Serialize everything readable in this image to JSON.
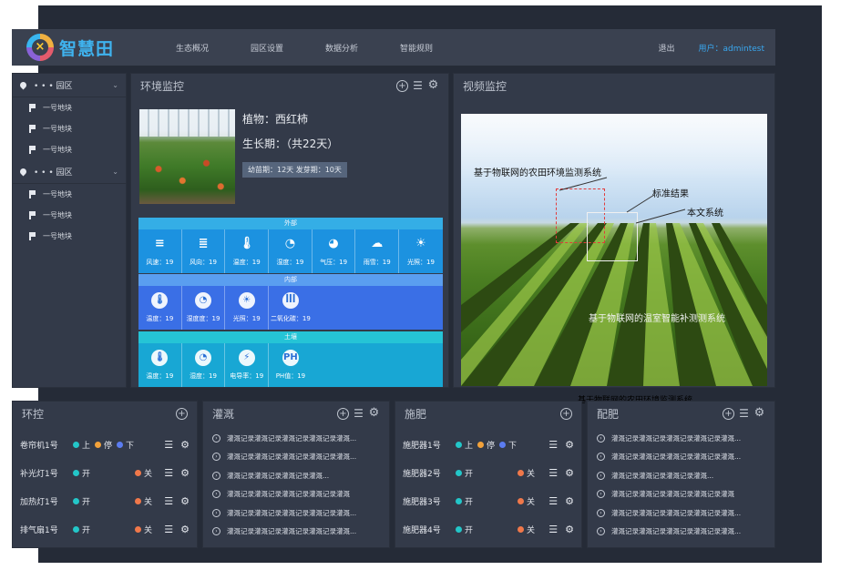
{
  "header": {
    "logo_text": "智慧田",
    "nav": [
      "生态概况",
      "园区设置",
      "数据分析",
      "智能规则"
    ],
    "logout": "退出",
    "user": "用户：admintest"
  },
  "sidebar": {
    "zones": [
      {
        "name": "• • • 园区",
        "blocks": [
          "一号地块",
          "一号地块",
          "一号地块"
        ]
      },
      {
        "name": "• • • 园区",
        "blocks": [
          "一号地块",
          "一号地块",
          "一号地块"
        ]
      }
    ]
  },
  "env_panel": {
    "title": "环境监控",
    "plant": "植物：西红柿",
    "cycle": "生长期：（共22天）",
    "stage": "幼苗期：12天 发芽期：10天",
    "outside": {
      "label": "外部",
      "items": [
        {
          "icon": "wind-speed-icon",
          "glyph": "≡",
          "label": "风速：19"
        },
        {
          "icon": "wind-direction-icon",
          "glyph": "≣",
          "label": "风向：19"
        },
        {
          "icon": "thermometer-icon",
          "glyph": "🌡",
          "label": "温度：19"
        },
        {
          "icon": "humidity-gauge-icon",
          "glyph": "◔",
          "label": "湿度：19"
        },
        {
          "icon": "pressure-gauge-icon",
          "glyph": "◕",
          "label": "气压：19"
        },
        {
          "icon": "rain-cloud-icon",
          "glyph": "☁",
          "label": "雨雪：19"
        },
        {
          "icon": "sun-icon",
          "glyph": "☀",
          "label": "光照：19"
        }
      ]
    },
    "inside": {
      "label": "内部",
      "items": [
        {
          "icon": "thermometer-icon",
          "glyph": "🌡",
          "label": "温度：19"
        },
        {
          "icon": "humidity-gauge-icon",
          "glyph": "◔",
          "label": "湿度度：19"
        },
        {
          "icon": "sun-icon",
          "glyph": "☀",
          "label": "光照：19"
        },
        {
          "icon": "co2-icon",
          "glyph": "ꟾꟾꟾ",
          "label": "二氧化碳：19"
        }
      ]
    },
    "soil": {
      "label": "土壤",
      "items": [
        {
          "icon": "thermometer-icon",
          "glyph": "🌡",
          "label": "温度：19"
        },
        {
          "icon": "humidity-gauge-icon",
          "glyph": "◔",
          "label": "湿度：19"
        },
        {
          "icon": "conductivity-icon",
          "glyph": "⚡",
          "label": "电导率：19"
        },
        {
          "icon": "ph-icon",
          "glyph": "PH",
          "label": "PH值：19"
        }
      ]
    }
  },
  "video_panel": {
    "title": "视频监控",
    "labels": {
      "system": "基于物联网的农田环境监测系统",
      "standard": "标准结果",
      "ours": "本文系统",
      "watermark": "基于物联网的温室智能补测测系统"
    },
    "caption": "基于物联网的农田环境监测系统"
  },
  "env_control": {
    "title": "环控",
    "rows": [
      {
        "name": "卷帘机1号",
        "options": [
          {
            "label": "上",
            "color": "teal"
          },
          {
            "label": "停",
            "color": "orange"
          },
          {
            "label": "下",
            "color": "blue"
          }
        ]
      },
      {
        "name": "补光灯1号",
        "options": [
          {
            "label": "开",
            "color": "teal"
          },
          {
            "label": "关",
            "color": "coral"
          }
        ]
      },
      {
        "name": "加热灯1号",
        "options": [
          {
            "label": "开",
            "color": "teal"
          },
          {
            "label": "关",
            "color": "coral"
          }
        ]
      },
      {
        "name": "排气扇1号",
        "options": [
          {
            "label": "开",
            "color": "teal"
          },
          {
            "label": "关",
            "color": "coral"
          }
        ]
      }
    ]
  },
  "irrigation": {
    "title": "灌溉",
    "records": [
      "灌溉记录灌溉记录灌溉记录灌溉记录灌溉...",
      "灌溉记录灌溉记录灌溉记录灌溉记录灌溉...",
      "灌溉记录灌溉记录灌溉记录灌溉...",
      "灌溉记录灌溉记录灌溉记录灌溉记录灌溉",
      "灌溉记录灌溉记录灌溉记录灌溉记录灌溉...",
      "灌溉记录灌溉记录灌溉记录灌溉记录灌溉..."
    ]
  },
  "fertilizer": {
    "title": "施肥",
    "rows": [
      {
        "name": "施肥器1号",
        "options": [
          {
            "label": "上",
            "color": "teal"
          },
          {
            "label": "停",
            "color": "orange"
          },
          {
            "label": "下",
            "color": "blue"
          }
        ]
      },
      {
        "name": "施肥器2号",
        "options": [
          {
            "label": "开",
            "color": "teal"
          },
          {
            "label": "关",
            "color": "coral"
          }
        ]
      },
      {
        "name": "施肥器3号",
        "options": [
          {
            "label": "开",
            "color": "teal"
          },
          {
            "label": "关",
            "color": "coral"
          }
        ]
      },
      {
        "name": "施肥器4号",
        "options": [
          {
            "label": "开",
            "color": "teal"
          },
          {
            "label": "关",
            "color": "coral"
          }
        ]
      }
    ]
  },
  "mixing": {
    "title": "配肥",
    "records": [
      "灌溉记录灌溉记录灌溉记录灌溉记录灌溉...",
      "灌溉记录灌溉记录灌溉记录灌溉记录灌溉...",
      "灌溉记录灌溉记录灌溉记录灌溉...",
      "灌溉记录灌溉记录灌溉记录灌溉记录灌溉",
      "灌溉记录灌溉记录灌溉记录灌溉记录灌溉...",
      "灌溉记录灌溉记录灌溉记录灌溉记录灌溉..."
    ]
  }
}
